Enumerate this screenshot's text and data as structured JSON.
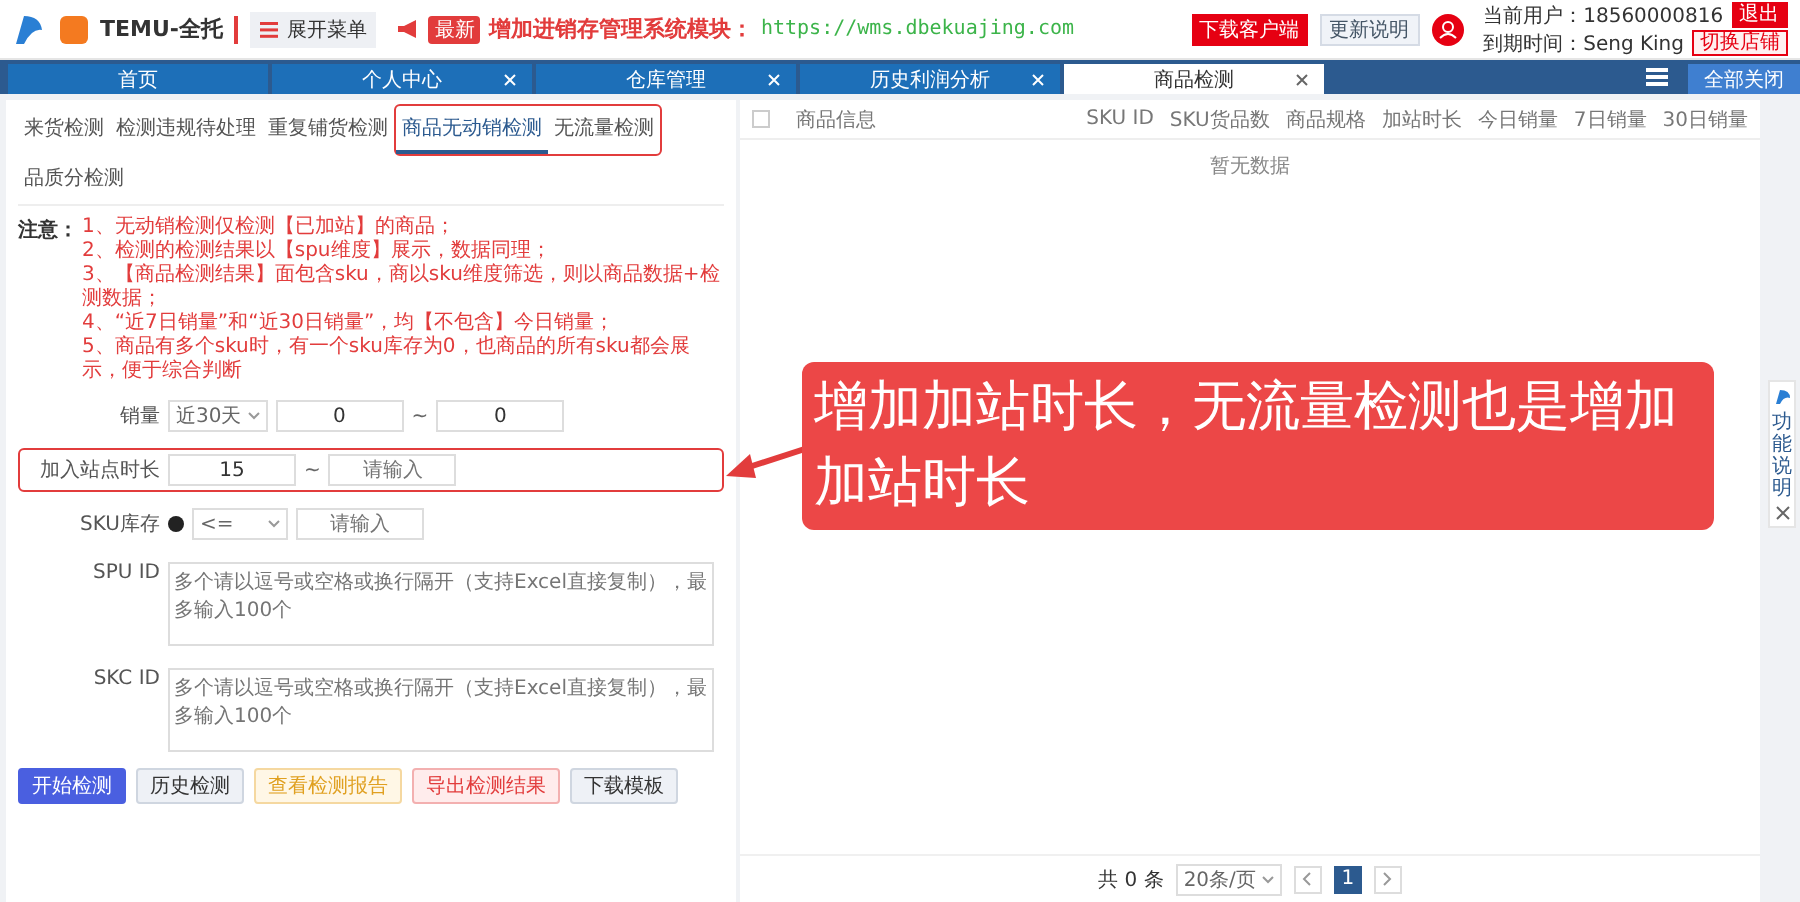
{
  "header": {
    "brand": "TEMU-全托",
    "menu_button": "展开菜单",
    "notice_badge": "最新",
    "notice": "增加进销存管理系统模块：",
    "notice_link": "https://wms.dbekuajing.com",
    "download_button": "下载客户端",
    "update_button": "更新说明",
    "user_label": "当前用户：18560000816",
    "logout": "退出",
    "expiry_label": "到期时间：Seng King",
    "switch_button": "切换店铺"
  },
  "tabs": [
    {
      "label": "首页",
      "closable": false,
      "selected": false
    },
    {
      "label": "个人中心",
      "closable": true,
      "selected": false
    },
    {
      "label": "仓库管理",
      "closable": true,
      "selected": false
    },
    {
      "label": "历史利润分析",
      "closable": true,
      "selected": false
    },
    {
      "label": "商品检测",
      "closable": true,
      "selected": true
    }
  ],
  "close_all": "全部关闭",
  "subtabs": [
    {
      "label": "来货检测",
      "selected": false,
      "highlighted": false
    },
    {
      "label": "检测违规待处理",
      "selected": false,
      "highlighted": false
    },
    {
      "label": "重复铺货检测",
      "selected": false,
      "highlighted": false
    },
    {
      "label": "商品无动销检测",
      "selected": true,
      "highlighted": true
    },
    {
      "label": "无流量检测",
      "selected": false,
      "highlighted": true
    },
    {
      "label": "品质分检测",
      "selected": false,
      "highlighted": false
    }
  ],
  "notes": {
    "title": "注意：",
    "items": [
      "1、无动销检测仅检测【已加站】的商品；",
      "2、检测的检测结果以【spu维度】展示，数据同理；",
      "3、【商品检测结果】面包含sku，商以sku维度筛选，则以商品数据+检测数据；",
      "4、“近7日销量”和“近30日销量”，均【不包含】今日销量；",
      "5、商品有多个sku时，有一个sku库存为0，也商品的所有sku都会展示，便于综合判断"
    ]
  },
  "form": [
    {
      "kind": "range",
      "label": "销量",
      "select": "近30天",
      "from": "0",
      "separator": "~",
      "to": "0",
      "highlighted": false
    },
    {
      "kind": "range",
      "label": "加入站点时长",
      "from": "15",
      "separator": "~",
      "to_placeholder": "请输入",
      "highlighted": true
    },
    {
      "kind": "compare",
      "label": "SKU库存",
      "select": "<=",
      "to_placeholder": "请输入",
      "highlighted": false
    },
    {
      "kind": "textarea",
      "label": "SPU ID",
      "placeholder": "多个请以逗号或空格或换行隔开（支持Excel直接复制），最多输入100个",
      "highlighted": false
    },
    {
      "kind": "textarea",
      "label": "SKC ID",
      "placeholder": "多个请以逗号或空格或换行隔开（支持Excel直接复制），最多输入100个",
      "highlighted": false
    }
  ],
  "actions": [
    {
      "label": "开始检测",
      "kind": "primary"
    },
    {
      "label": "历史检测",
      "kind": "plain"
    },
    {
      "label": "查看检测报告",
      "kind": "warning"
    },
    {
      "label": "导出检测结果",
      "kind": "danger"
    },
    {
      "label": "下载模板",
      "kind": "default"
    }
  ],
  "table": {
    "select_all_checked": false,
    "columns": [
      "商品信息",
      "SKU ID",
      "SKU货品数",
      "商品规格",
      "加站时长",
      "今日销量",
      "7日销量",
      "30日销量"
    ],
    "empty": "暂无数据"
  },
  "pagination": {
    "total": "共 0 条",
    "page_size": "20条/页",
    "pages": [
      {
        "label": "1",
        "selected": true
      }
    ]
  },
  "callout": "增加加站时长，无流量检测也是增加加站时长",
  "side_help": {
    "label": "功能说明"
  }
}
